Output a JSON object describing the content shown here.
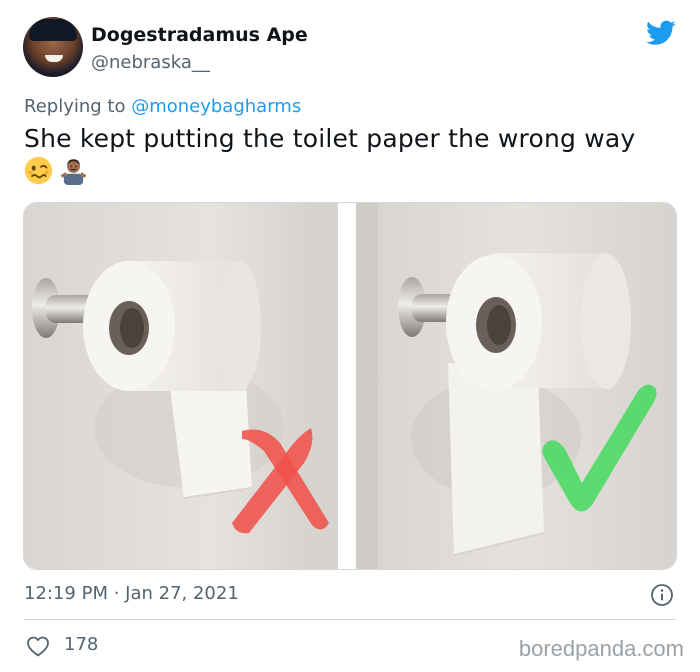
{
  "author": {
    "display_name": "Dogestradamus Ape",
    "handle": "@nebraska__"
  },
  "reply": {
    "prefix": "Replying to ",
    "mention": "@moneybagharms"
  },
  "tweet": {
    "text": "She kept putting the toilet paper the wrong way",
    "emojis": [
      "woozy-face-icon",
      "person-shrugging-icon"
    ]
  },
  "media": {
    "left_mark": "cross",
    "left_mark_color": "#f0524a",
    "right_mark": "check",
    "right_mark_color": "#4cd964"
  },
  "meta": {
    "timestamp": "12:19 PM · Jan 27, 2021"
  },
  "actions": {
    "likes": "178"
  },
  "watermark": "boredpanda.com",
  "colors": {
    "brand": "#1d9bf0",
    "muted": "#536471"
  }
}
